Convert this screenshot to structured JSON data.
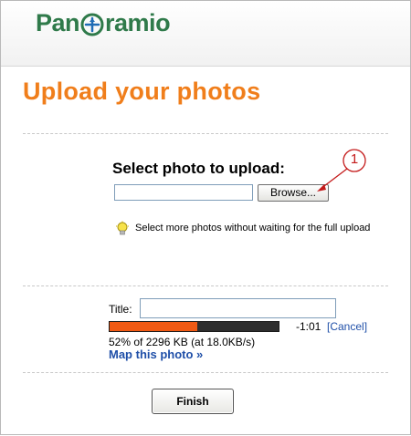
{
  "header": {
    "logo_prefix": "Pan",
    "logo_suffix": "ramio",
    "logo_color": "#2f7a4a",
    "logo_icon": "globe-plane-icon"
  },
  "page": {
    "title": "Upload your photos",
    "title_color": "#f07e1b"
  },
  "upload": {
    "select_label": "Select photo to upload:",
    "file_value": "",
    "browse_label": "Browse...",
    "callout_number": "1",
    "tip_icon": "lightbulb-icon",
    "tip_text": "Select more photos without waiting for the full upload"
  },
  "photo": {
    "title_label": "Title:",
    "title_value": "",
    "progress_percent": 52,
    "time_left": "-1:01",
    "cancel_label": "Cancel",
    "status": "52% of 2296 KB (at 18.0KB/s)",
    "map_link": "Map this photo »",
    "finish_label": "Finish"
  },
  "colors": {
    "progress_fill": "#f05a14",
    "progress_track": "#2e2e2e",
    "link": "#1f4fa8",
    "callout": "#c41a1a"
  }
}
